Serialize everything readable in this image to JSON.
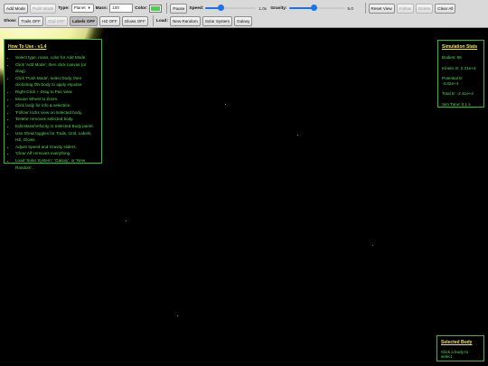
{
  "toolbar": {
    "add_mode": "Add Mode",
    "push_mode": "Push Mode",
    "type_label": "Type:",
    "type_value": "Planet",
    "mass_label": "Mass:",
    "mass_value": "100",
    "color_label": "Color:",
    "color_value": "#4cd14c",
    "pause": "Pause",
    "speed_label": "Speed:",
    "speed_fraction": 0.3,
    "speed_value": "1.0x",
    "gravity_label": "Gravity:",
    "gravity_fraction": 0.45,
    "gravity_value": "5.0",
    "reset_view": "Reset View",
    "follow": "Follow",
    "delete": "Delete",
    "clear_all": "Clear All",
    "show_label": "Show:",
    "trails": "Trails OFF",
    "grid": "Grid OFF",
    "labels": "Labels OFF",
    "hz": "HZ OFF",
    "glows": "Glows OFF",
    "load_label": "Load:",
    "new_random": "New Random",
    "solar_system": "Solar System",
    "galaxy": "Galaxy"
  },
  "help": {
    "title": "How To Use - v1.4",
    "items": [
      "Select type, mass, color for Add Mode.",
      "Click 'Add Mode', then click canvas (or drag).",
      "Click 'Push Mode', select body, then click/drag ON body to apply impulse.",
      "Right-Click + Drag to Pan view.",
      "Mouse Wheel to Zoom.",
      "Click body for info & selection.",
      "'Follow' locks view on selected body.",
      "'Delete' removes selected body.",
      "Edit Mass/Velocity in Selected Body panel.",
      "Use Show toggles for Trails, Grid, Labels, HZ, Glows.",
      "Adjust Speed and Gravity sliders.",
      "'Clear All' removes everything.",
      "Load 'Solar System', 'Galaxy', or 'New Random'."
    ]
  },
  "stats": {
    "title": "Simulation Stats",
    "bodies": "Bodies: 56",
    "kinetic": "Kinetic E: 2.41e+4",
    "potential": "Potential E: -4.82e+4",
    "total": "Total E: -2.41e+4",
    "sim_time": "Sim Time: 0.1 s"
  },
  "selected": {
    "title": "Selected Body",
    "hint": "Click a body to select"
  }
}
